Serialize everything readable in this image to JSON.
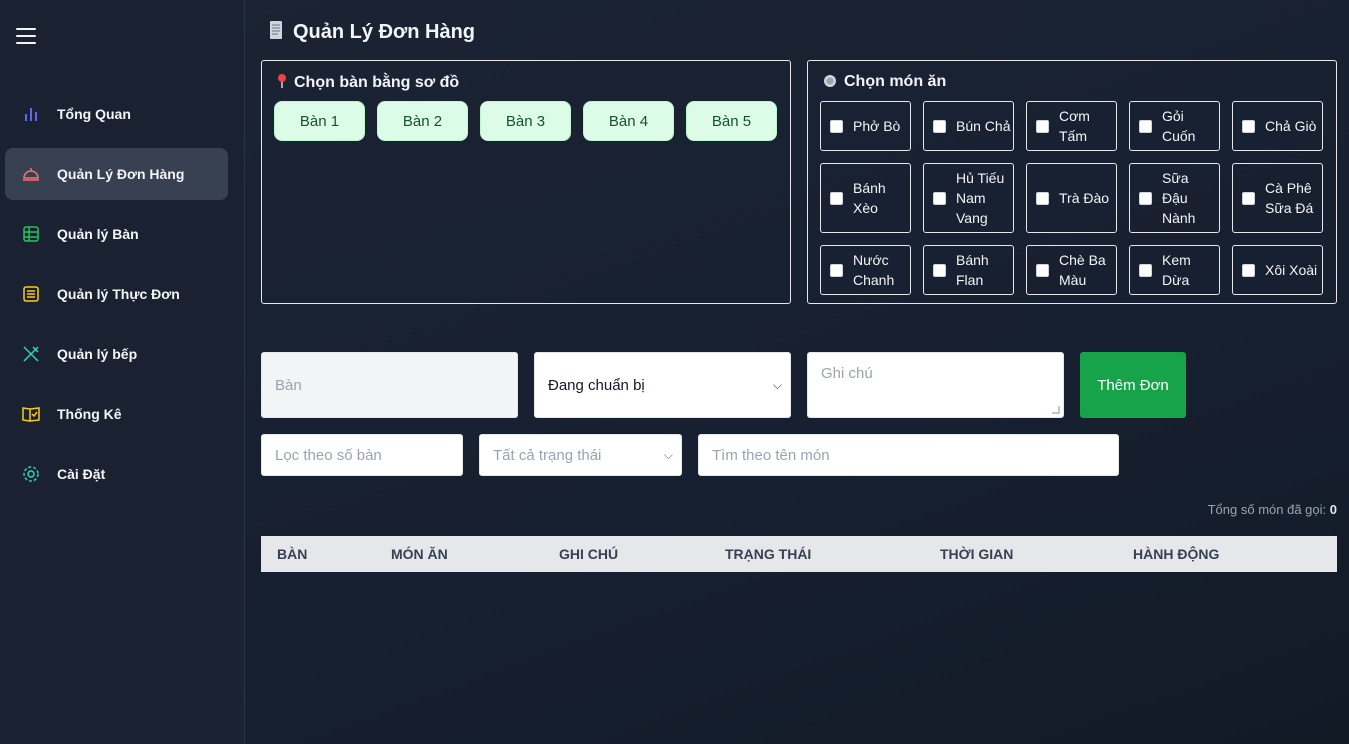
{
  "sidebar": {
    "items": [
      {
        "label": "Tổng Quan",
        "icon": "bar-chart-icon",
        "color": "#6366f1",
        "active": false
      },
      {
        "label": "Quản Lý Đơn Hàng",
        "icon": "service-bell-icon",
        "color": "#f87171",
        "active": true
      },
      {
        "label": "Quản lý Bàn",
        "icon": "table-grid-icon",
        "color": "#22c55e",
        "active": false
      },
      {
        "label": "Quản lý Thực Đơn",
        "icon": "menu-list-icon",
        "color": "#facc15",
        "active": false
      },
      {
        "label": "Quản lý bếp",
        "icon": "utensils-icon",
        "color": "#2dd4bf",
        "active": false
      },
      {
        "label": "Thống Kê",
        "icon": "book-check-icon",
        "color": "#facc15",
        "active": false
      },
      {
        "label": "Cài Đặt",
        "icon": "gear-icon",
        "color": "#2dd4bf",
        "active": false
      }
    ]
  },
  "page": {
    "title": "Quản Lý Đơn Hàng",
    "title_icon": "receipt-icon"
  },
  "table_panel": {
    "title": "Chọn bàn bằng sơ đồ",
    "icon": "pin-icon",
    "tables": [
      "Bàn 1",
      "Bàn 2",
      "Bàn 3",
      "Bàn 4",
      "Bàn 5"
    ]
  },
  "dish_panel": {
    "title": "Chọn món ăn",
    "icon": "plate-icon",
    "dishes": [
      [
        "Phở Bò",
        "Bún Chả",
        "Cơm Tấm",
        "Gỏi Cuốn",
        "Chả Giò"
      ],
      [
        "Bánh Xèo",
        "Hủ Tiếu Nam Vang",
        "Trà Đào",
        "Sữa Đậu Nành",
        "Cà Phê Sữa Đá"
      ],
      [
        "Nước Chanh",
        "Bánh Flan",
        "Chè Ba Màu",
        "Kem Dừa",
        "Xôi Xoài"
      ]
    ]
  },
  "form": {
    "ban_placeholder": "Bàn",
    "status_value": "Đang chuẩn bị",
    "note_placeholder": "Ghi chú",
    "add_label": "Thêm Đơn"
  },
  "filters": {
    "table_placeholder": "Lọc theo số bàn",
    "status_value": "Tất cả trạng thái",
    "search_placeholder": "Tìm theo tên món"
  },
  "summary": {
    "label": "Tổng số món đã gọi:",
    "count": "0"
  },
  "orders_table": {
    "headers": [
      "BÀN",
      "MÓN ĂN",
      "GHI CHÚ",
      "TRẠNG THÁI",
      "THỜI GIAN",
      "HÀNH ĐỘNG"
    ]
  },
  "colors": {
    "accent_green": "#16a34a",
    "table_button_bg": "#dcfce7",
    "active_nav_bg": "#374151"
  }
}
